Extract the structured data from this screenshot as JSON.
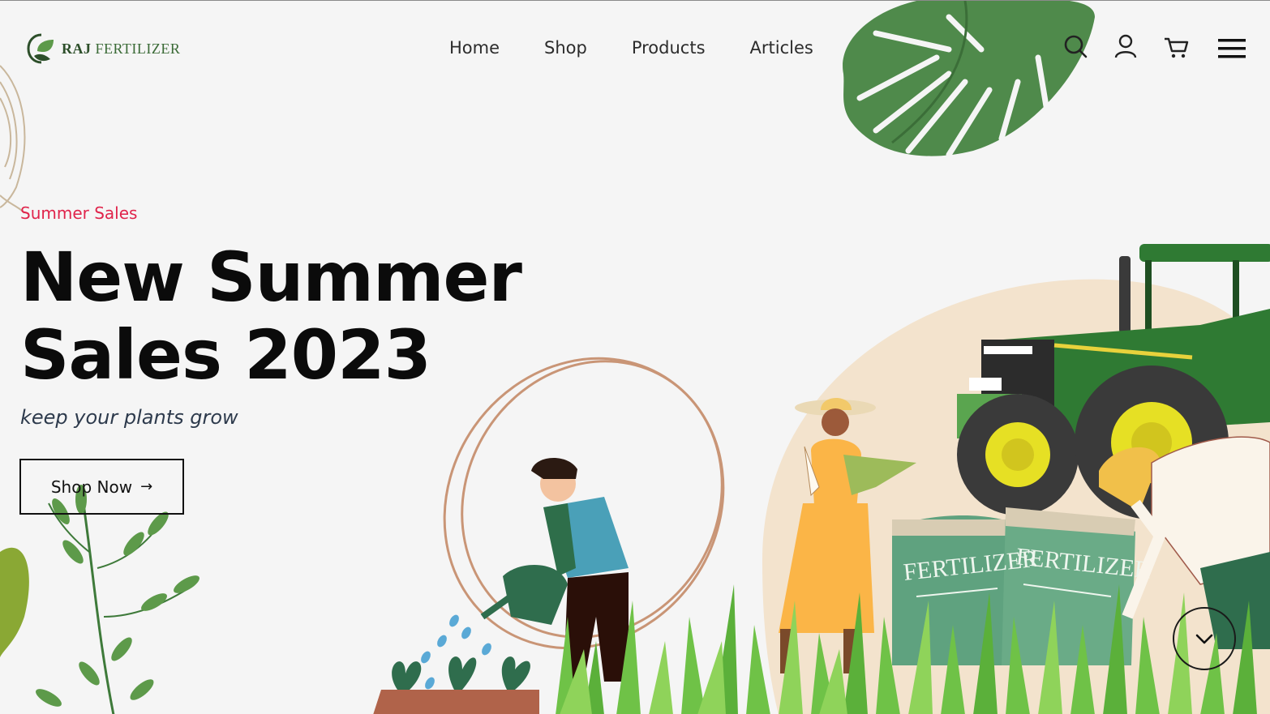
{
  "brand": {
    "name_bold": "RAJ",
    "name_rest": " FERTILIZER",
    "color": "#3a6a36"
  },
  "nav": {
    "items": [
      {
        "label": "Home"
      },
      {
        "label": "Shop"
      },
      {
        "label": "Products"
      },
      {
        "label": "Articles"
      }
    ]
  },
  "header_icons": [
    "search-icon",
    "user-icon",
    "cart-icon",
    "menu-icon"
  ],
  "hero": {
    "eyebrow": "Summer Sales",
    "headline_line1": "New Summer",
    "headline_line2": "Sales 2023",
    "tagline": "keep your plants grow",
    "cta_label": "Shop Now",
    "cta_icon": "arrow-right-icon"
  },
  "illustration": {
    "bag_label_1": "FERTILIZER",
    "bag_label_2": "FERTILIZER"
  },
  "colors": {
    "accent_red": "#e0244b",
    "leaf_green": "#4f8a4b",
    "tractor_green": "#2f7a33",
    "bag_green": "#5fa27f"
  }
}
